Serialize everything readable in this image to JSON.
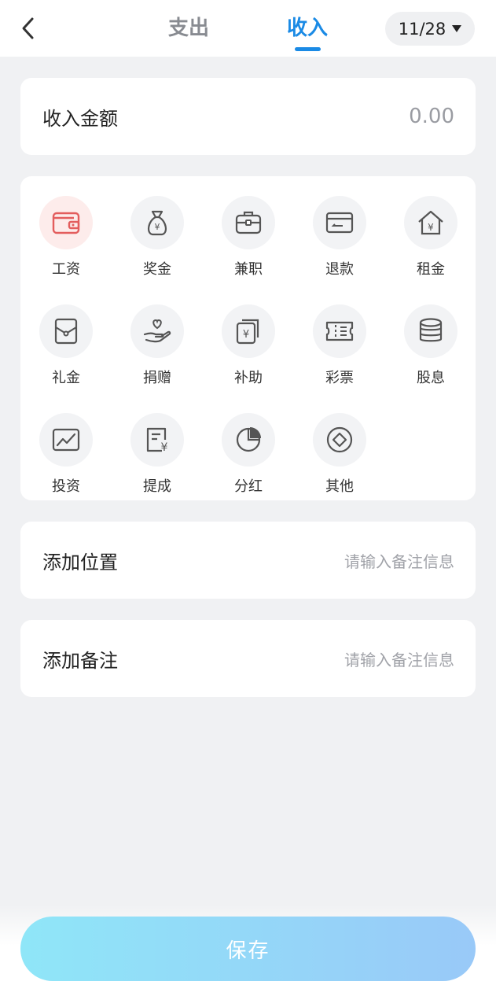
{
  "header": {
    "tab_expense": "支出",
    "tab_income": "收入",
    "date": "11/28",
    "active_color": "#1a8ae5"
  },
  "amount": {
    "label": "收入金额",
    "value": "0.00"
  },
  "categories": [
    {
      "label": "工资",
      "icon": "wallet-icon",
      "active": true
    },
    {
      "label": "奖金",
      "icon": "money-bag-icon"
    },
    {
      "label": "兼职",
      "icon": "briefcase-icon"
    },
    {
      "label": "退款",
      "icon": "card-refund-icon"
    },
    {
      "label": "租金",
      "icon": "house-yen-icon"
    },
    {
      "label": "礼金",
      "icon": "envelope-icon"
    },
    {
      "label": "捐赠",
      "icon": "hand-heart-icon"
    },
    {
      "label": "补助",
      "icon": "stacked-yen-icon"
    },
    {
      "label": "彩票",
      "icon": "ticket-icon"
    },
    {
      "label": "股息",
      "icon": "coin-stack-icon"
    },
    {
      "label": "投资",
      "icon": "trend-chart-icon"
    },
    {
      "label": "提成",
      "icon": "receipt-yen-icon"
    },
    {
      "label": "分红",
      "icon": "pie-chart-icon"
    },
    {
      "label": "其他",
      "icon": "diamond-circle-icon"
    }
  ],
  "location": {
    "label": "添加位置",
    "placeholder": "请输入备注信息"
  },
  "note": {
    "label": "添加备注",
    "placeholder": "请输入备注信息"
  },
  "save_label": "保存"
}
